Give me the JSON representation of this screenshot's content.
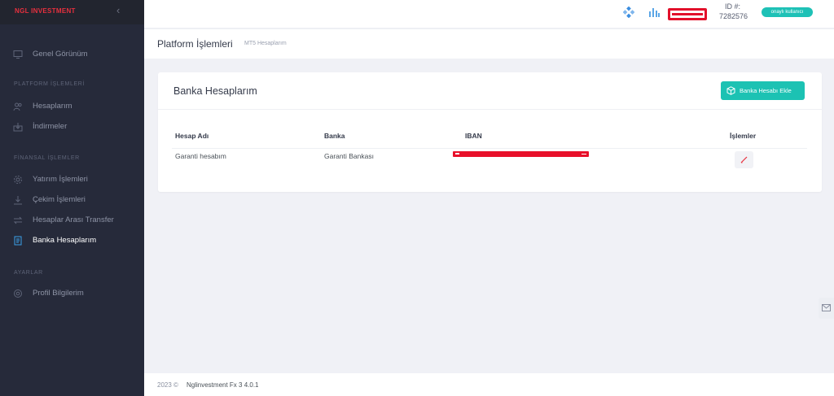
{
  "brand": {
    "logo_text": "NGL INVESTMENT",
    "accent": "#e8303e"
  },
  "sidebar": {
    "overview": {
      "label": "Genel Görünüm",
      "icon": "monitor-icon"
    },
    "sections": [
      {
        "title": "PLATFORM İŞLEMLERİ",
        "items": [
          {
            "label": "Hesaplarım",
            "icon": "users-icon"
          },
          {
            "label": "İndirmeler",
            "icon": "download-box-icon"
          }
        ]
      },
      {
        "title": "FİNANSAL İŞLEMLER",
        "items": [
          {
            "label": "Yatırım İşlemleri",
            "icon": "gear-icon"
          },
          {
            "label": "Çekim İşlemleri",
            "icon": "download-icon"
          },
          {
            "label": "Hesaplar Arası Transfer",
            "icon": "transfer-icon"
          },
          {
            "label": "Banka Hesaplarım",
            "icon": "bank-card-icon",
            "active": true
          }
        ]
      },
      {
        "title": "AYARLAR",
        "items": [
          {
            "label": "Profil Bilgilerim",
            "icon": "settings-icon"
          }
        ]
      }
    ]
  },
  "topbar": {
    "id_label": "ID #:",
    "id_value": "7282576",
    "status_badge": "onaylı kullanıcı",
    "badge_color": "#1ec1b6"
  },
  "page": {
    "title": "Platform İşlemleri",
    "breadcrumb": "MT5 Hesaplarım"
  },
  "card": {
    "title": "Banka Hesaplarım",
    "add_button": "Banka Hesabı Ekle",
    "columns": [
      "Hesap Adı",
      "Banka",
      "IBAN",
      "İşlemler"
    ],
    "rows": [
      {
        "account_name": "Garanti hesabım",
        "bank": "Garanti Bankası"
      }
    ]
  },
  "footer": {
    "copyright": "2023 ©",
    "app": "Nglinvestment Fx 3 4.0.1"
  }
}
